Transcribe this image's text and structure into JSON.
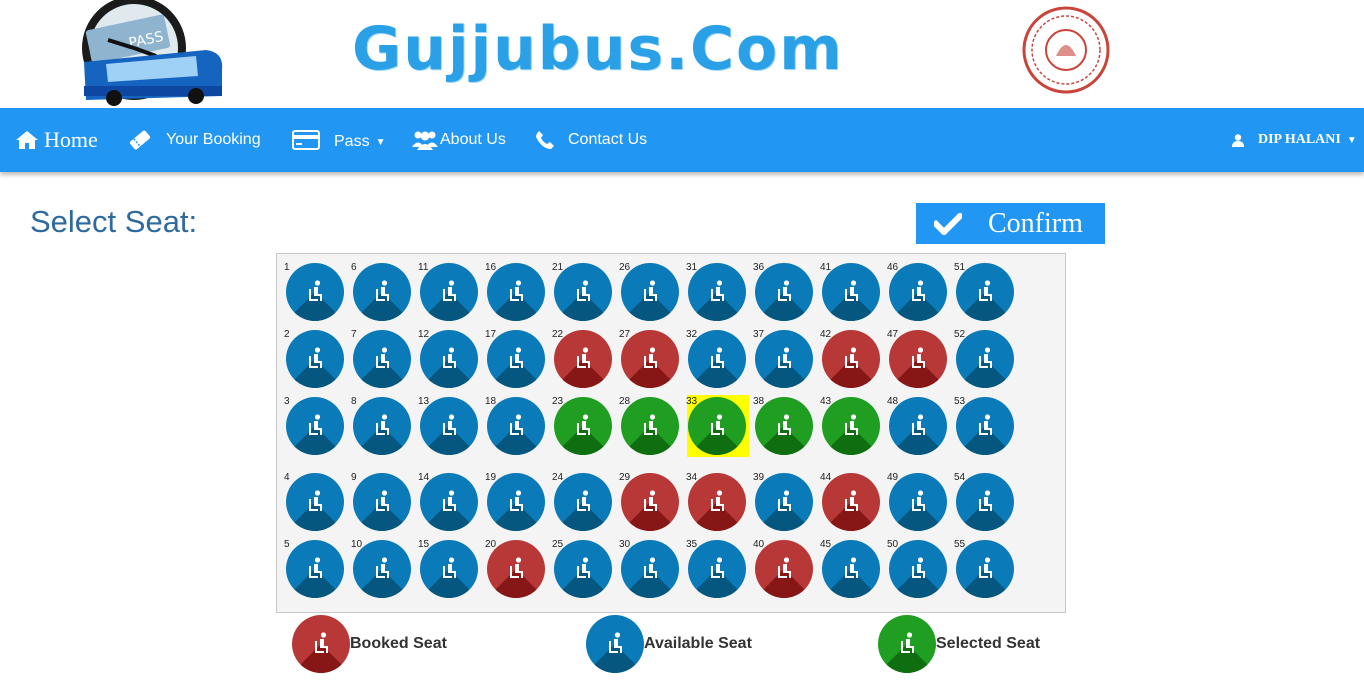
{
  "header": {
    "brand": "Gujjubus.Com",
    "logo_icon": "bus-clock-logo-icon",
    "seal_icon": "emblem-seal-icon"
  },
  "nav": {
    "home": "Home",
    "booking": "Your Booking",
    "pass": "Pass",
    "about": "About Us",
    "contact": "Contact Us",
    "user": "DIP HALANI"
  },
  "page": {
    "title": "Select Seat:",
    "confirm": "Confirm"
  },
  "seats": {
    "booked": [
      20,
      22,
      27,
      29,
      34,
      40,
      42,
      44,
      47
    ],
    "selected": [
      23,
      28,
      33,
      38,
      43
    ],
    "highlighted": 33,
    "total": 55
  },
  "colors": {
    "primary": "#2196f3",
    "available": "#0a7ab8",
    "booked": "#b83838",
    "selected": "#1f9e21",
    "highlight": "#ffff00"
  },
  "legend": {
    "booked": "Booked Seat",
    "available": "Available Seat",
    "selected": "Selected Seat"
  }
}
